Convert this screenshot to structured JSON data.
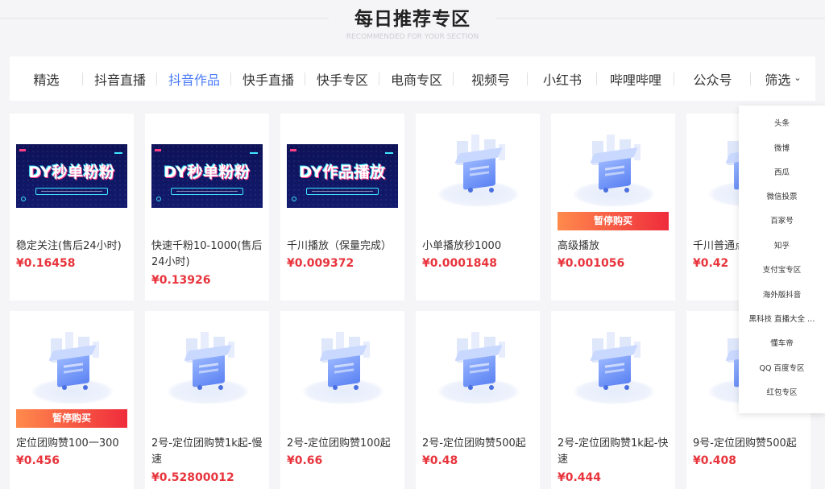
{
  "header": {
    "title": "每日推荐专区",
    "subtitle": "RECOMMENDED FOR YOUR SECTION"
  },
  "tabs": [
    {
      "label": "精选",
      "active": false
    },
    {
      "label": "抖音直播",
      "active": false
    },
    {
      "label": "抖音作品",
      "active": true
    },
    {
      "label": "快手直播",
      "active": false
    },
    {
      "label": "快手专区",
      "active": false
    },
    {
      "label": "电商专区",
      "active": false
    },
    {
      "label": "视频号",
      "active": false
    },
    {
      "label": "小红书",
      "active": false
    },
    {
      "label": "哔哩哔哩",
      "active": false
    },
    {
      "label": "公众号",
      "active": false
    },
    {
      "label": "筛选",
      "active": false
    }
  ],
  "filter_menu": [
    "头条",
    "微博",
    "西瓜",
    "微信投票",
    "百家号",
    "知乎",
    "支付宝专区",
    "海外版抖音",
    "黑科技 直播大全 …",
    "懂车帝",
    "QQ 百度专区",
    "红包专区"
  ],
  "products": [
    {
      "thumb": "DY秒单粉粉",
      "name": "稳定关注(售后24小时)",
      "price": "¥0.16458",
      "badge": ""
    },
    {
      "thumb": "DY秒单粉粉",
      "name": "快速千粉10-1000(售后24小时)",
      "price": "¥0.13926",
      "badge": ""
    },
    {
      "thumb": "DY作品播放",
      "name": "千川播放（保量完成）",
      "price": "¥0.009372",
      "badge": ""
    },
    {
      "thumb": "",
      "name": "小单播放秒1000",
      "price": "¥0.0001848",
      "badge": ""
    },
    {
      "thumb": "",
      "name": "高级播放",
      "price": "¥0.001056",
      "badge": "暂停购买"
    },
    {
      "thumb": "",
      "name": "千川普通点",
      "price": "¥0.42",
      "badge": ""
    },
    {
      "thumb": "",
      "name": "定位团购赞100一300",
      "price": "¥0.456",
      "badge": "暂停购买"
    },
    {
      "thumb": "",
      "name": "2号-定位团购赞1k起-慢速",
      "price": "¥0.52800012",
      "badge": ""
    },
    {
      "thumb": "",
      "name": "2号-定位团购赞100起",
      "price": "¥0.66",
      "badge": ""
    },
    {
      "thumb": "",
      "name": "2号-定位团购赞500起",
      "price": "¥0.48",
      "badge": ""
    },
    {
      "thumb": "",
      "name": "2号-定位团购赞1k起-快速",
      "price": "¥0.444",
      "badge": ""
    },
    {
      "thumb": "",
      "name": "9号-定位团购赞500起",
      "price": "¥0.408",
      "badge": ""
    }
  ],
  "colors": {
    "accent": "#4a7cf6",
    "price": "#e8343c",
    "badge_start": "#ff8a4c",
    "badge_end": "#ef2c3c"
  },
  "icons": {
    "filter_chevron": "chevron-down-icon",
    "placeholder": "shopping-cart-illustration-icon"
  }
}
